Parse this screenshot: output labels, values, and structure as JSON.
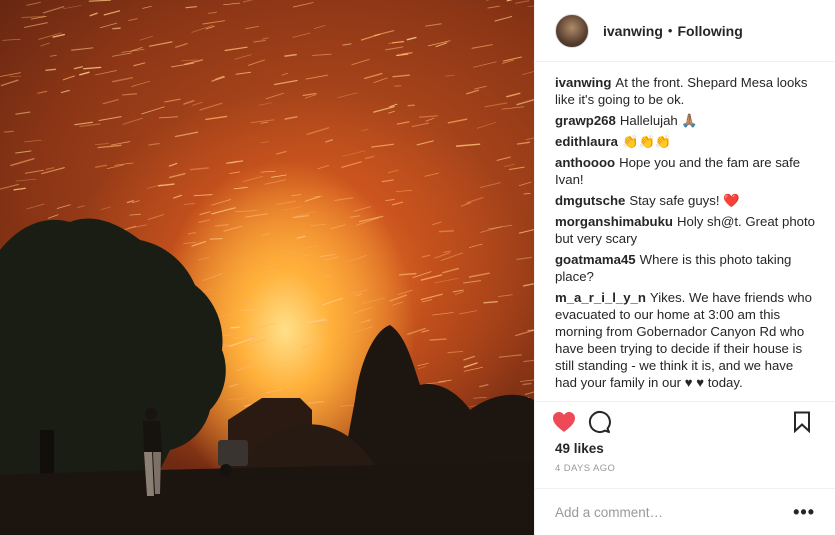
{
  "post": {
    "username": "ivanwing",
    "separator": "•",
    "follow_status": "Following",
    "image_alt": "Nighttime wildfire with sparks blowing over trees and a standing figure"
  },
  "comments": [
    {
      "user": "ivanwing",
      "text": "At the front. Shepard Mesa looks like it's going to be ok."
    },
    {
      "user": "grawp268",
      "text": "Hallelujah 🙏🏽"
    },
    {
      "user": "edithlaura",
      "text": "👏👏👏"
    },
    {
      "user": "anthoooo",
      "text": "Hope you and the fam are safe Ivan!"
    },
    {
      "user": "dmgutsche",
      "text": "Stay safe guys! ❤️"
    },
    {
      "user": "morganshimabuku",
      "text": "Holy sh@t. Great photo but very scary"
    },
    {
      "user": "goatmama45",
      "text": "Where is this photo taking place?"
    },
    {
      "user": "m_a_r_i_l_y_n",
      "text": "Yikes. We have friends who evacuated to our home at 3:00 am this morning from Gobernador Canyon Rd who have been trying to decide if their house is still standing - we think it is, and we have had your family in our ♥ ♥ today."
    }
  ],
  "actions": {
    "likes": "49 likes",
    "timestamp": "4 DAYS AGO",
    "like_icon": "heart-icon",
    "comment_icon": "speech-bubble-icon",
    "save_icon": "bookmark-icon",
    "heart_color": "#ed4956"
  },
  "add_comment": {
    "placeholder": "Add a comment…",
    "more_label": "•••"
  }
}
